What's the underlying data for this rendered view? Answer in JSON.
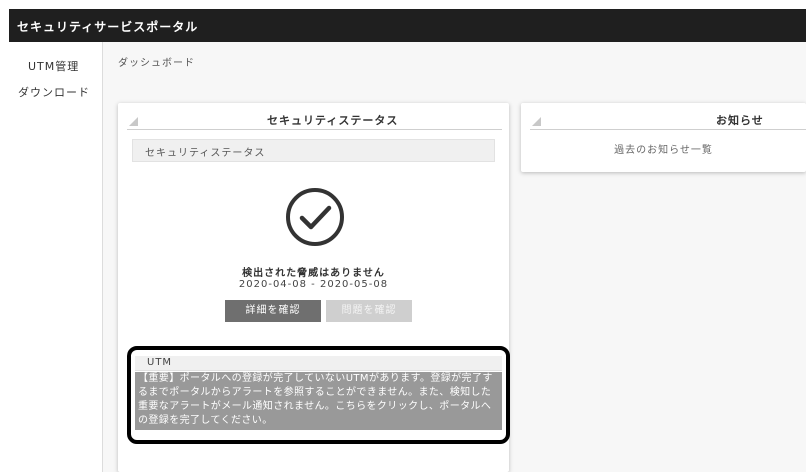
{
  "app": {
    "title": "セキュリティサービスポータル"
  },
  "sidebar": {
    "items": [
      {
        "label": "UTM管理"
      },
      {
        "label": "ダウンロード"
      }
    ]
  },
  "breadcrumb": {
    "current": "ダッシュボード"
  },
  "status_card": {
    "title": "セキュリティステータス",
    "subtitle": "セキュリティステータス",
    "icon": "check-circle-icon",
    "message": "検出された脅威はありません",
    "date_range": "2020-04-08 - 2020-05-08",
    "detail_button": "詳細を確認",
    "report_button": "問題を確認",
    "utm_label": "UTM",
    "utm_notice": "【重要】ポータルへの登録が完了していないUTMがあります。登録が完了するまでポータルからアラートを参照することができません。また、検知した重要なアラートがメール通知されません。こちらをクリックし、ポータルへの登録を完了してください。"
  },
  "news_card": {
    "title": "お知らせ",
    "link": "過去のお知らせ一覧"
  },
  "colors": {
    "topbar": "#1f1f1f",
    "primary_button": "#6f6f6f",
    "disabled_button": "#cfcfcf",
    "notice_bg": "#999999"
  }
}
